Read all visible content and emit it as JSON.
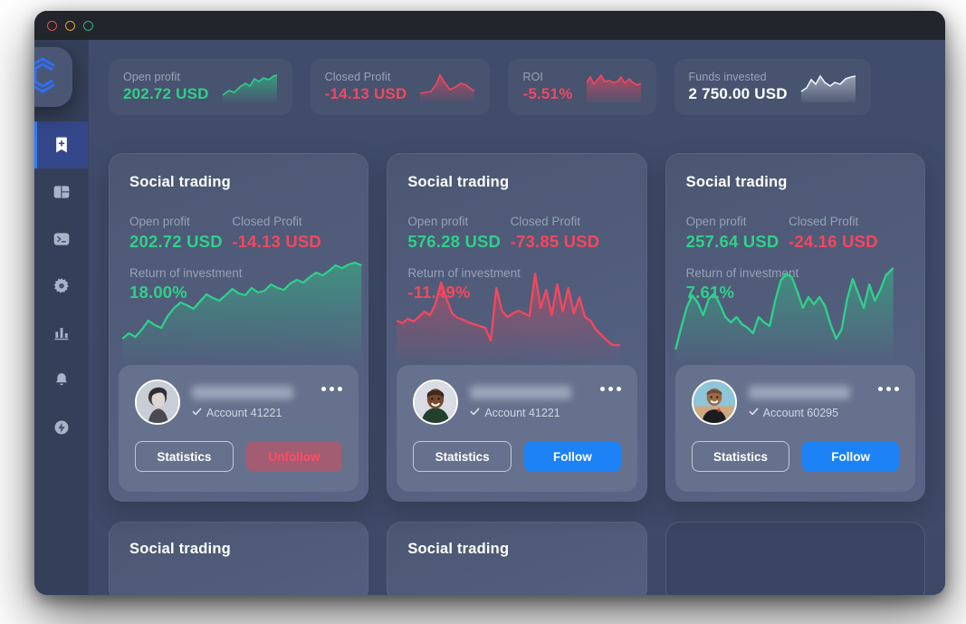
{
  "window": {
    "traffic_lights": [
      "close",
      "minimize",
      "maximize"
    ]
  },
  "brand": {
    "logo_icon": "hexagon-c-logo",
    "accent": "#2f7ef7"
  },
  "sidebar": {
    "items": [
      {
        "icon": "bookmark-plus-icon",
        "name": "sidebar-item-saved",
        "active": true
      },
      {
        "icon": "layout-dashboard-icon",
        "name": "sidebar-item-dashboard",
        "active": false
      },
      {
        "icon": "terminal-icon",
        "name": "sidebar-item-terminal",
        "active": false
      },
      {
        "icon": "gear-icon",
        "name": "sidebar-item-settings",
        "active": false
      },
      {
        "icon": "bar-chart-icon",
        "name": "sidebar-item-analytics",
        "active": false
      },
      {
        "icon": "bell-icon",
        "name": "sidebar-item-notifications",
        "active": false
      },
      {
        "icon": "lightning-circle-icon",
        "name": "sidebar-item-activity",
        "active": false
      }
    ]
  },
  "header_stats": [
    {
      "label": "Open profit",
      "value": "202.72 USD",
      "tone": "green",
      "spark": "spark-green-up"
    },
    {
      "label": "Closed Profit",
      "value": "-14.13 USD",
      "tone": "red",
      "spark": "spark-red-peak"
    },
    {
      "label": "ROI",
      "value": "-5.51%",
      "tone": "red",
      "spark": "spark-red-volatile"
    },
    {
      "label": "Funds invested",
      "value": "2 750.00 USD",
      "tone": "white",
      "spark": "spark-white-up"
    }
  ],
  "colors": {
    "green": "#2fd08a",
    "red": "#f4475e",
    "blue": "#1d82f5",
    "unfollow_bg": "#a25d72",
    "card_bg": "#525e7d",
    "window_bg": "#3d4a68"
  },
  "labels": {
    "open_profit": "Open profit",
    "closed_profit": "Closed Profit",
    "return_of_investment": "Return of investment",
    "account_prefix": "Account",
    "verified_icon": "check-icon",
    "more_icon": "more-horizontal-icon"
  },
  "cards": [
    {
      "title": "Social trading",
      "open_profit": "202.72 USD",
      "closed_profit": "-14.13 USD",
      "roi": "18.00%",
      "roi_tone": "green",
      "chart_tone": "green",
      "account": "Account 41221",
      "name_redacted": true,
      "avatar": "avatar-portrait-1",
      "statistics_label": "Statistics",
      "action_label": "Unfollow",
      "action_kind": "unfollow"
    },
    {
      "title": "Social trading",
      "open_profit": "576.28 USD",
      "closed_profit": "-73.85  USD",
      "roi": "-11.49%",
      "roi_tone": "red",
      "chart_tone": "red",
      "account": "Account 41221",
      "name_redacted": true,
      "avatar": "avatar-portrait-2",
      "statistics_label": "Statistics",
      "action_label": "Follow",
      "action_kind": "follow"
    },
    {
      "title": "Social trading",
      "open_profit": "257.64 USD",
      "closed_profit": "-24.16 USD",
      "roi": "7.61%",
      "roi_tone": "green",
      "chart_tone": "green",
      "account": "Account 60295",
      "name_redacted": true,
      "avatar": "avatar-portrait-3",
      "statistics_label": "Statistics",
      "action_label": "Follow",
      "action_kind": "follow"
    }
  ],
  "bottom_cards": [
    {
      "title": "Social trading",
      "empty": false
    },
    {
      "title": "Social trading",
      "empty": false
    },
    {
      "title": "",
      "empty": true
    }
  ],
  "chart_data": [
    {
      "type": "area",
      "title": "Return of investment",
      "series_name": "card-1-roi",
      "color": "#2fd08a",
      "final_value": 18.0,
      "unit": "%",
      "y": [
        20,
        23,
        21,
        26,
        32,
        29,
        27,
        33,
        40,
        45,
        43,
        41,
        47,
        52,
        50,
        48,
        54,
        60,
        57,
        55,
        62,
        58,
        60,
        66,
        63,
        61,
        68,
        72,
        70,
        75,
        80,
        78,
        82,
        88,
        86,
        84,
        90,
        95,
        100
      ]
    },
    {
      "type": "area",
      "title": "Return of investment",
      "series_name": "card-2-roi",
      "color": "#f4475e",
      "final_value": -11.49,
      "unit": "%",
      "y": [
        40,
        38,
        42,
        40,
        44,
        48,
        46,
        52,
        70,
        60,
        50,
        46,
        44,
        42,
        40,
        38,
        36,
        10,
        62,
        48,
        44,
        46,
        48,
        46,
        44,
        88,
        52,
        72,
        46,
        78,
        50,
        74,
        48,
        66,
        44,
        42,
        30,
        26,
        20,
        14
      ]
    },
    {
      "type": "area",
      "title": "Return of investment",
      "series_name": "card-3-roi",
      "color": "#2fd08a",
      "final_value": 7.61,
      "unit": "%",
      "y": [
        8,
        30,
        52,
        66,
        58,
        46,
        62,
        68,
        58,
        46,
        40,
        44,
        38,
        34,
        30,
        44,
        40,
        36,
        62,
        84,
        92,
        88,
        72,
        56,
        66,
        60,
        68,
        58,
        40,
        26,
        34,
        62,
        84,
        70,
        56,
        80,
        62,
        74,
        90,
        96
      ]
    }
  ]
}
